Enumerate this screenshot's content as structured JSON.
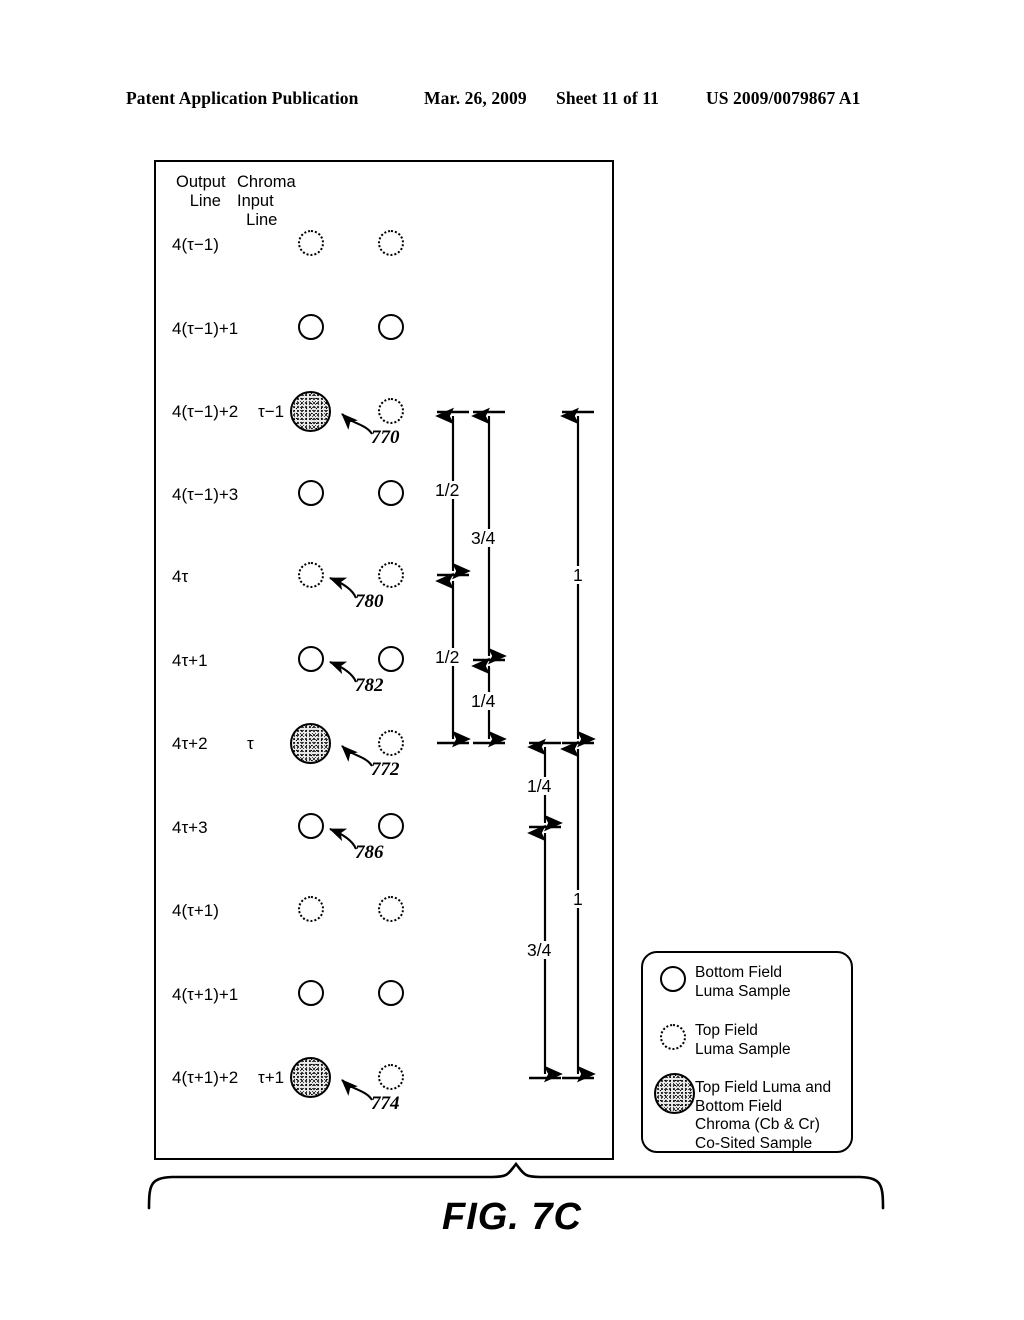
{
  "header": {
    "publication": "Patent Application Publication",
    "date": "Mar. 26, 2009",
    "sheet": "Sheet 11 of 11",
    "patent_number": "US 2009/0079867 A1"
  },
  "figure": {
    "caption": "FIG. 7C"
  },
  "columns": {
    "output_line": "Output\n  Line",
    "chroma_input_line": "Chroma\nInput\n  Line"
  },
  "rows": [
    {
      "output_line": "4(τ−1)",
      "chroma_line": "",
      "left_marker": "dotted",
      "right_marker": "dotted"
    },
    {
      "output_line": "4(τ−1)+1",
      "chroma_line": "",
      "left_marker": "solid",
      "right_marker": "solid"
    },
    {
      "output_line": "4(τ−1)+2",
      "chroma_line": "τ−1",
      "left_marker": "filled",
      "right_marker": "dotted"
    },
    {
      "output_line": "4(τ−1)+3",
      "chroma_line": "",
      "left_marker": "solid",
      "right_marker": "solid"
    },
    {
      "output_line": "4τ",
      "chroma_line": "",
      "left_marker": "dotted",
      "right_marker": "dotted"
    },
    {
      "output_line": "4τ+1",
      "chroma_line": "",
      "left_marker": "solid",
      "right_marker": "solid"
    },
    {
      "output_line": "4τ+2",
      "chroma_line": "τ",
      "left_marker": "filled",
      "right_marker": "dotted"
    },
    {
      "output_line": "4τ+3",
      "chroma_line": "",
      "left_marker": "solid",
      "right_marker": "solid"
    },
    {
      "output_line": "4(τ+1)",
      "chroma_line": "",
      "left_marker": "dotted",
      "right_marker": "dotted"
    },
    {
      "output_line": "4(τ+1)+1",
      "chroma_line": "",
      "left_marker": "solid",
      "right_marker": "solid"
    },
    {
      "output_line": "4(τ+1)+2",
      "chroma_line": "τ+1",
      "left_marker": "filled",
      "right_marker": "dotted"
    }
  ],
  "reference_numerals": [
    {
      "id": "770",
      "label": "770"
    },
    {
      "id": "780",
      "label": "780"
    },
    {
      "id": "782",
      "label": "782"
    },
    {
      "id": "772",
      "label": "772"
    },
    {
      "id": "786",
      "label": "786"
    },
    {
      "id": "774",
      "label": "774"
    }
  ],
  "dimensions": {
    "upper_group": {
      "bar_a": [
        "1/2",
        "1/2"
      ],
      "bar_b": [
        "3/4",
        "1/4"
      ],
      "bar_c": [
        "1"
      ]
    },
    "lower_group": {
      "bar_d": [
        "1/4",
        "3/4"
      ],
      "bar_e": [
        "1"
      ]
    }
  },
  "legend": {
    "entries": [
      {
        "marker": "solid",
        "text": "Bottom Field\nLuma Sample"
      },
      {
        "marker": "dotted",
        "text": "Top Field\nLuma Sample"
      },
      {
        "marker": "filled",
        "text": "Top Field Luma and\nBottom Field\nChroma (Cb & Cr)\nCo-Sited Sample"
      }
    ]
  },
  "chart_data": {
    "type": "scatter",
    "title": "FIG. 7C",
    "description": "Chroma upsampling / co-siting diagram mapping output luma lines to chroma input lines for interlaced top/bottom fields.",
    "xlabel": "",
    "ylabel": "Output Line",
    "grid": false,
    "legend_position": "bottom-right",
    "categories": [
      "4(τ−1)",
      "4(τ−1)+1",
      "4(τ−1)+2",
      "4(τ−1)+3",
      "4τ",
      "4τ+1",
      "4τ+2",
      "4τ+3",
      "4(τ+1)",
      "4(τ+1)+1",
      "4(τ+1)+2"
    ],
    "chroma_input_lines": [
      "",
      "",
      "τ−1",
      "",
      "",
      "",
      "τ",
      "",
      "",
      "",
      "τ+1"
    ],
    "series": [
      {
        "name": "Output column markers",
        "values": [
          "dotted",
          "solid",
          "filled",
          "solid",
          "dotted",
          "solid",
          "filled",
          "solid",
          "dotted",
          "solid",
          "filled"
        ]
      },
      {
        "name": "Chroma column markers",
        "values": [
          "dotted",
          "solid",
          "dotted",
          "solid",
          "dotted",
          "solid",
          "dotted",
          "solid",
          "dotted",
          "solid",
          "dotted"
        ]
      }
    ],
    "annotations": [
      "770",
      "780",
      "782",
      "772",
      "786",
      "774"
    ],
    "distance_labels": [
      "1/2",
      "3/4",
      "1/2",
      "1/4",
      "1",
      "1/4",
      "3/4",
      "1"
    ]
  }
}
